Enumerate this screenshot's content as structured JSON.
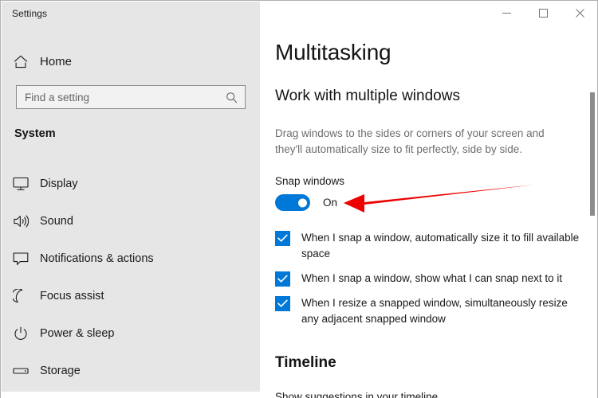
{
  "window": {
    "title": "Settings",
    "controls": {
      "minimize": "minimize-button",
      "maximize": "maximize-button",
      "close": "close-button"
    }
  },
  "sidebar": {
    "home_label": "Home",
    "home_icon": "home-icon",
    "search": {
      "placeholder": "Find a setting",
      "value": "",
      "icon": "search-icon"
    },
    "section_title": "System",
    "items": [
      {
        "label": "Display",
        "icon": "monitor-icon"
      },
      {
        "label": "Sound",
        "icon": "speaker-icon"
      },
      {
        "label": "Notifications & actions",
        "icon": "chat-bubble-icon"
      },
      {
        "label": "Focus assist",
        "icon": "moon-icon"
      },
      {
        "label": "Power & sleep",
        "icon": "power-icon"
      },
      {
        "label": "Storage",
        "icon": "drive-icon"
      }
    ]
  },
  "main": {
    "page_title": "Multitasking",
    "sub_heading": "Work with multiple windows",
    "description": "Drag windows to the sides or corners of your screen and they'll automatically size to fit perfectly, side by side.",
    "snap": {
      "label": "Snap windows",
      "toggle_state": "On",
      "toggle_on": true
    },
    "checkboxes": [
      {
        "label": "When I snap a window, automatically size it to fill available space",
        "checked": true
      },
      {
        "label": "When I snap a window, show what I can snap next to it",
        "checked": true
      },
      {
        "label": "When I resize a snapped window, simultaneously resize any adjacent snapped window",
        "checked": true
      }
    ],
    "timeline": {
      "heading": "Timeline",
      "sub_label": "Show suggestions in your timeline"
    }
  },
  "annotation": {
    "type": "red-arrow",
    "color": "#ee0000",
    "points_to": "snap-windows-toggle"
  },
  "colors": {
    "accent_blue": "#0078d7",
    "sidebar_bg": "#e6e6e6",
    "content_bg": "#ffffff",
    "text_primary": "#1a1a1a",
    "text_secondary": "#6e6e6e",
    "annotation_red": "#ee0000"
  }
}
